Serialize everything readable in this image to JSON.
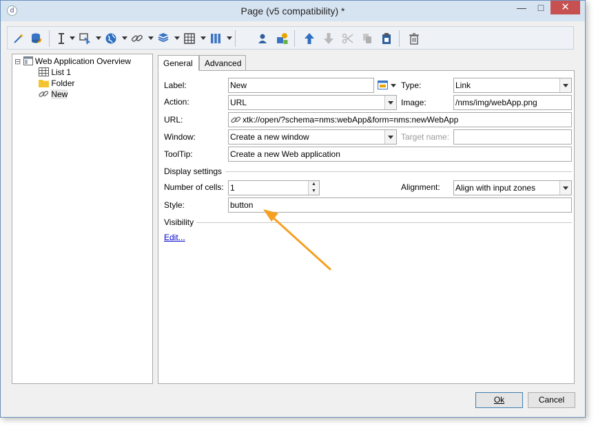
{
  "window": {
    "title": "Page (v5 compatibility) *",
    "app_icon_glyph": "d",
    "minimize_glyph": "—",
    "maximize_glyph": "□",
    "close_glyph": "✕"
  },
  "toolbar": {
    "icons": [
      "magic-wand-icon",
      "database-icon",
      "text-insert-icon",
      "form-input-icon",
      "globe-icon",
      "link-icon",
      "container-icon",
      "table-icon",
      "columns-icon",
      "user-icon",
      "add-component-icon",
      "move-up-icon",
      "move-down-icon",
      "cut-icon",
      "copy-icon",
      "paste-icon",
      "delete-icon"
    ]
  },
  "tree": {
    "expander": "⊟",
    "root": "Web Application Overview",
    "items": [
      "List 1",
      "Folder",
      "New"
    ]
  },
  "tabs": [
    "General",
    "Advanced"
  ],
  "form": {
    "label_label": "Label:",
    "label_value": "New",
    "type_label": "Type:",
    "type_value": "Link",
    "action_label": "Action:",
    "action_value": "URL",
    "image_label": "Image:",
    "image_value": "/nms/img/webApp.png",
    "url_label": "URL:",
    "url_value": "xtk://open/?schema=nms:webApp&form=nms:newWebApp",
    "window_label": "Window:",
    "window_value": "Create a new window",
    "target_label": "Target name:",
    "target_value": "",
    "tooltip_label": "ToolTip:",
    "tooltip_value": "Create a new Web application",
    "display_settings": "Display settings",
    "cells_label": "Number of cells:",
    "cells_value": "1",
    "alignment_label": "Alignment:",
    "alignment_value": "Align with input zones",
    "style_label": "Style:",
    "style_value": "button",
    "visibility": "Visibility",
    "edit_link": "Edit..."
  },
  "buttons": {
    "ok": "Ok",
    "cancel": "Cancel"
  },
  "colors": {
    "accent": "#1e6fc6",
    "arrow": "#f5a021",
    "close": "#c75050",
    "link": "#0000cc"
  }
}
